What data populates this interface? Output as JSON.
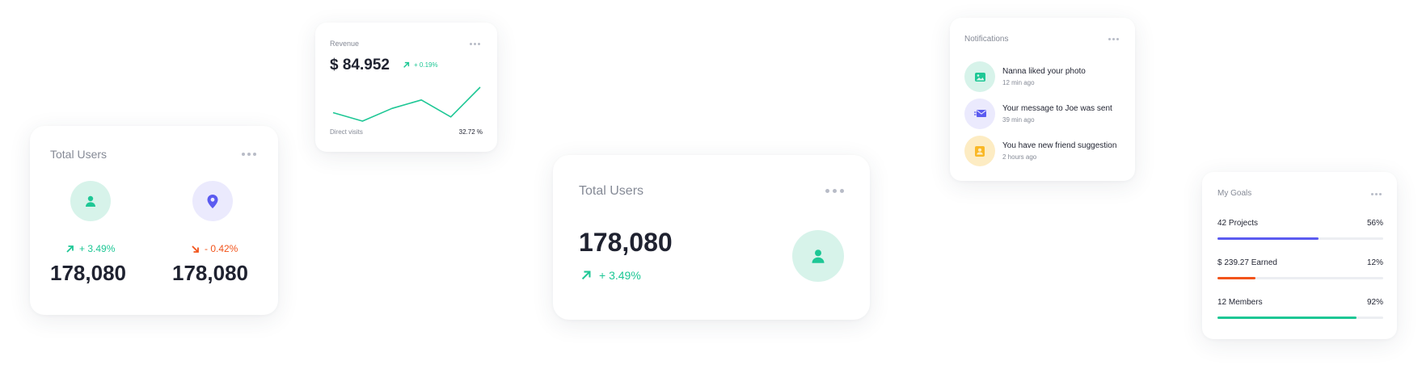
{
  "colors": {
    "green": "#1ec795",
    "red": "#f2541b",
    "purple": "#5b5bf0",
    "yellow": "#f9b826"
  },
  "card_users_a": {
    "title": "Total Users",
    "metrics": [
      {
        "icon": "user-icon",
        "change": "+ 3.49%",
        "trend": "up",
        "value": "178,080"
      },
      {
        "icon": "location-pin-icon",
        "change": "- 0.42%",
        "trend": "down",
        "value": "178,080"
      }
    ]
  },
  "revenue": {
    "title": "Revenue",
    "amount": "$ 84.952",
    "change": "+ 0.19%",
    "sparkline": [
      3,
      1,
      4,
      6,
      2,
      9
    ],
    "footer_label": "Direct visits",
    "footer_value": "32.72 %"
  },
  "card_users_b": {
    "title": "Total Users",
    "value": "178,080",
    "change": "+ 3.49%",
    "icon": "user-icon"
  },
  "notifications": {
    "title": "Notifications",
    "items": [
      {
        "text": "Nanna liked your photo",
        "time": "12 min ago",
        "icon": "image-icon"
      },
      {
        "text": "Your message to Joe was sent",
        "time": "39 min ago",
        "icon": "send-mail-icon"
      },
      {
        "text": "You have new friend suggestion",
        "time": "2 hours ago",
        "icon": "contact-icon"
      }
    ]
  },
  "goals": {
    "title": "My Goals",
    "items": [
      {
        "label": "42 Projects",
        "percent_label": "56%",
        "progress": 0.61,
        "color": "#5b5bf0"
      },
      {
        "label": "$ 239.27 Earned",
        "percent_label": "12%",
        "progress": 0.23,
        "color": "#f2541b"
      },
      {
        "label": "12 Members",
        "percent_label": "92%",
        "progress": 0.84,
        "color": "#1ec795"
      }
    ]
  }
}
